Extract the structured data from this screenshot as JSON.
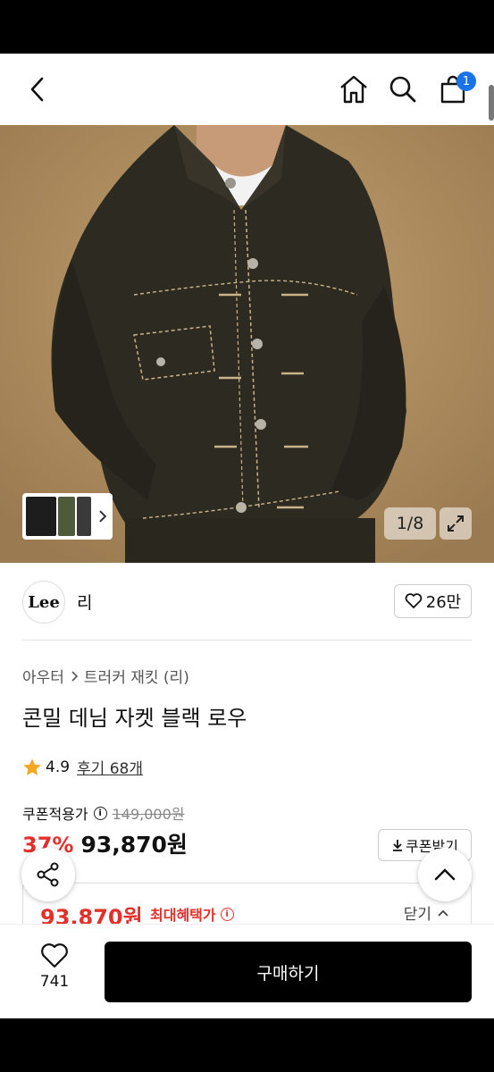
{
  "header": {
    "cart_count": "1"
  },
  "gallery": {
    "counter": "1/8"
  },
  "brand": {
    "logo_text": "Lee",
    "name": "리",
    "likes": "26만"
  },
  "breadcrumb": {
    "category": "아우터",
    "subcategory": "트러커 재킷 (리)"
  },
  "product": {
    "title": "콘밀 데님 자켓 블랙 로우",
    "rating": "4.9",
    "reviews": "후기 68개"
  },
  "pricing": {
    "coupon_label": "쿠폰적용가",
    "original_price": "149,000원",
    "discount": "37%",
    "price": "93,870원",
    "coupon_button": "쿠폰받기",
    "benefit_price": "93,870원",
    "benefit_label": "최대혜택가",
    "close_label": "닫기"
  },
  "bottom_bar": {
    "wish_count": "741",
    "buy_label": "구매하기"
  },
  "colors": {
    "accent_red": "#e4302b",
    "badge_blue": "#1a73e8"
  }
}
